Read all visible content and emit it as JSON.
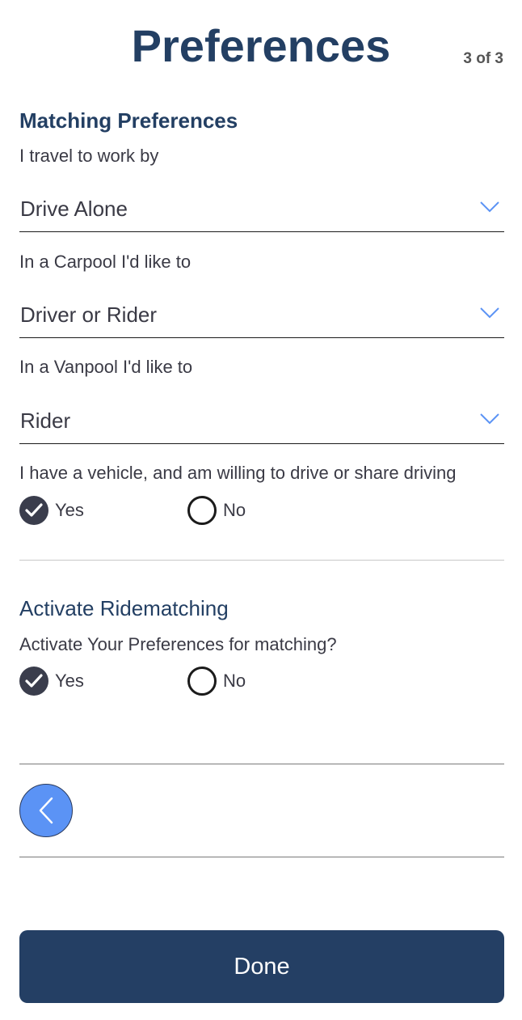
{
  "header": {
    "title": "Preferences",
    "step": "3 of 3"
  },
  "matching": {
    "heading": "Matching Preferences",
    "travel": {
      "label": "I travel to work by",
      "value": "Drive Alone"
    },
    "carpool": {
      "label": "In a Carpool I'd like to",
      "value": "Driver or Rider"
    },
    "vanpool": {
      "label": "In a Vanpool I'd like to",
      "value": "Rider"
    },
    "vehicle": {
      "label": "I have a vehicle, and am willing to drive or share driving",
      "yes_label": "Yes",
      "no_label": "No",
      "selected": "Yes"
    }
  },
  "ridematching": {
    "heading": "Activate Ridematching",
    "question": "Activate Your Preferences for matching?",
    "yes_label": "Yes",
    "no_label": "No",
    "selected": "Yes"
  },
  "footer": {
    "done_label": "Done"
  },
  "colors": {
    "title": "#233f63",
    "accent_blue": "#5b93f5",
    "done_button": "#243f64",
    "radio_checked": "#3a3d4c"
  },
  "icons": {
    "dropdown": "chevron-down-icon",
    "checked": "check-icon",
    "back": "chevron-left-icon"
  }
}
